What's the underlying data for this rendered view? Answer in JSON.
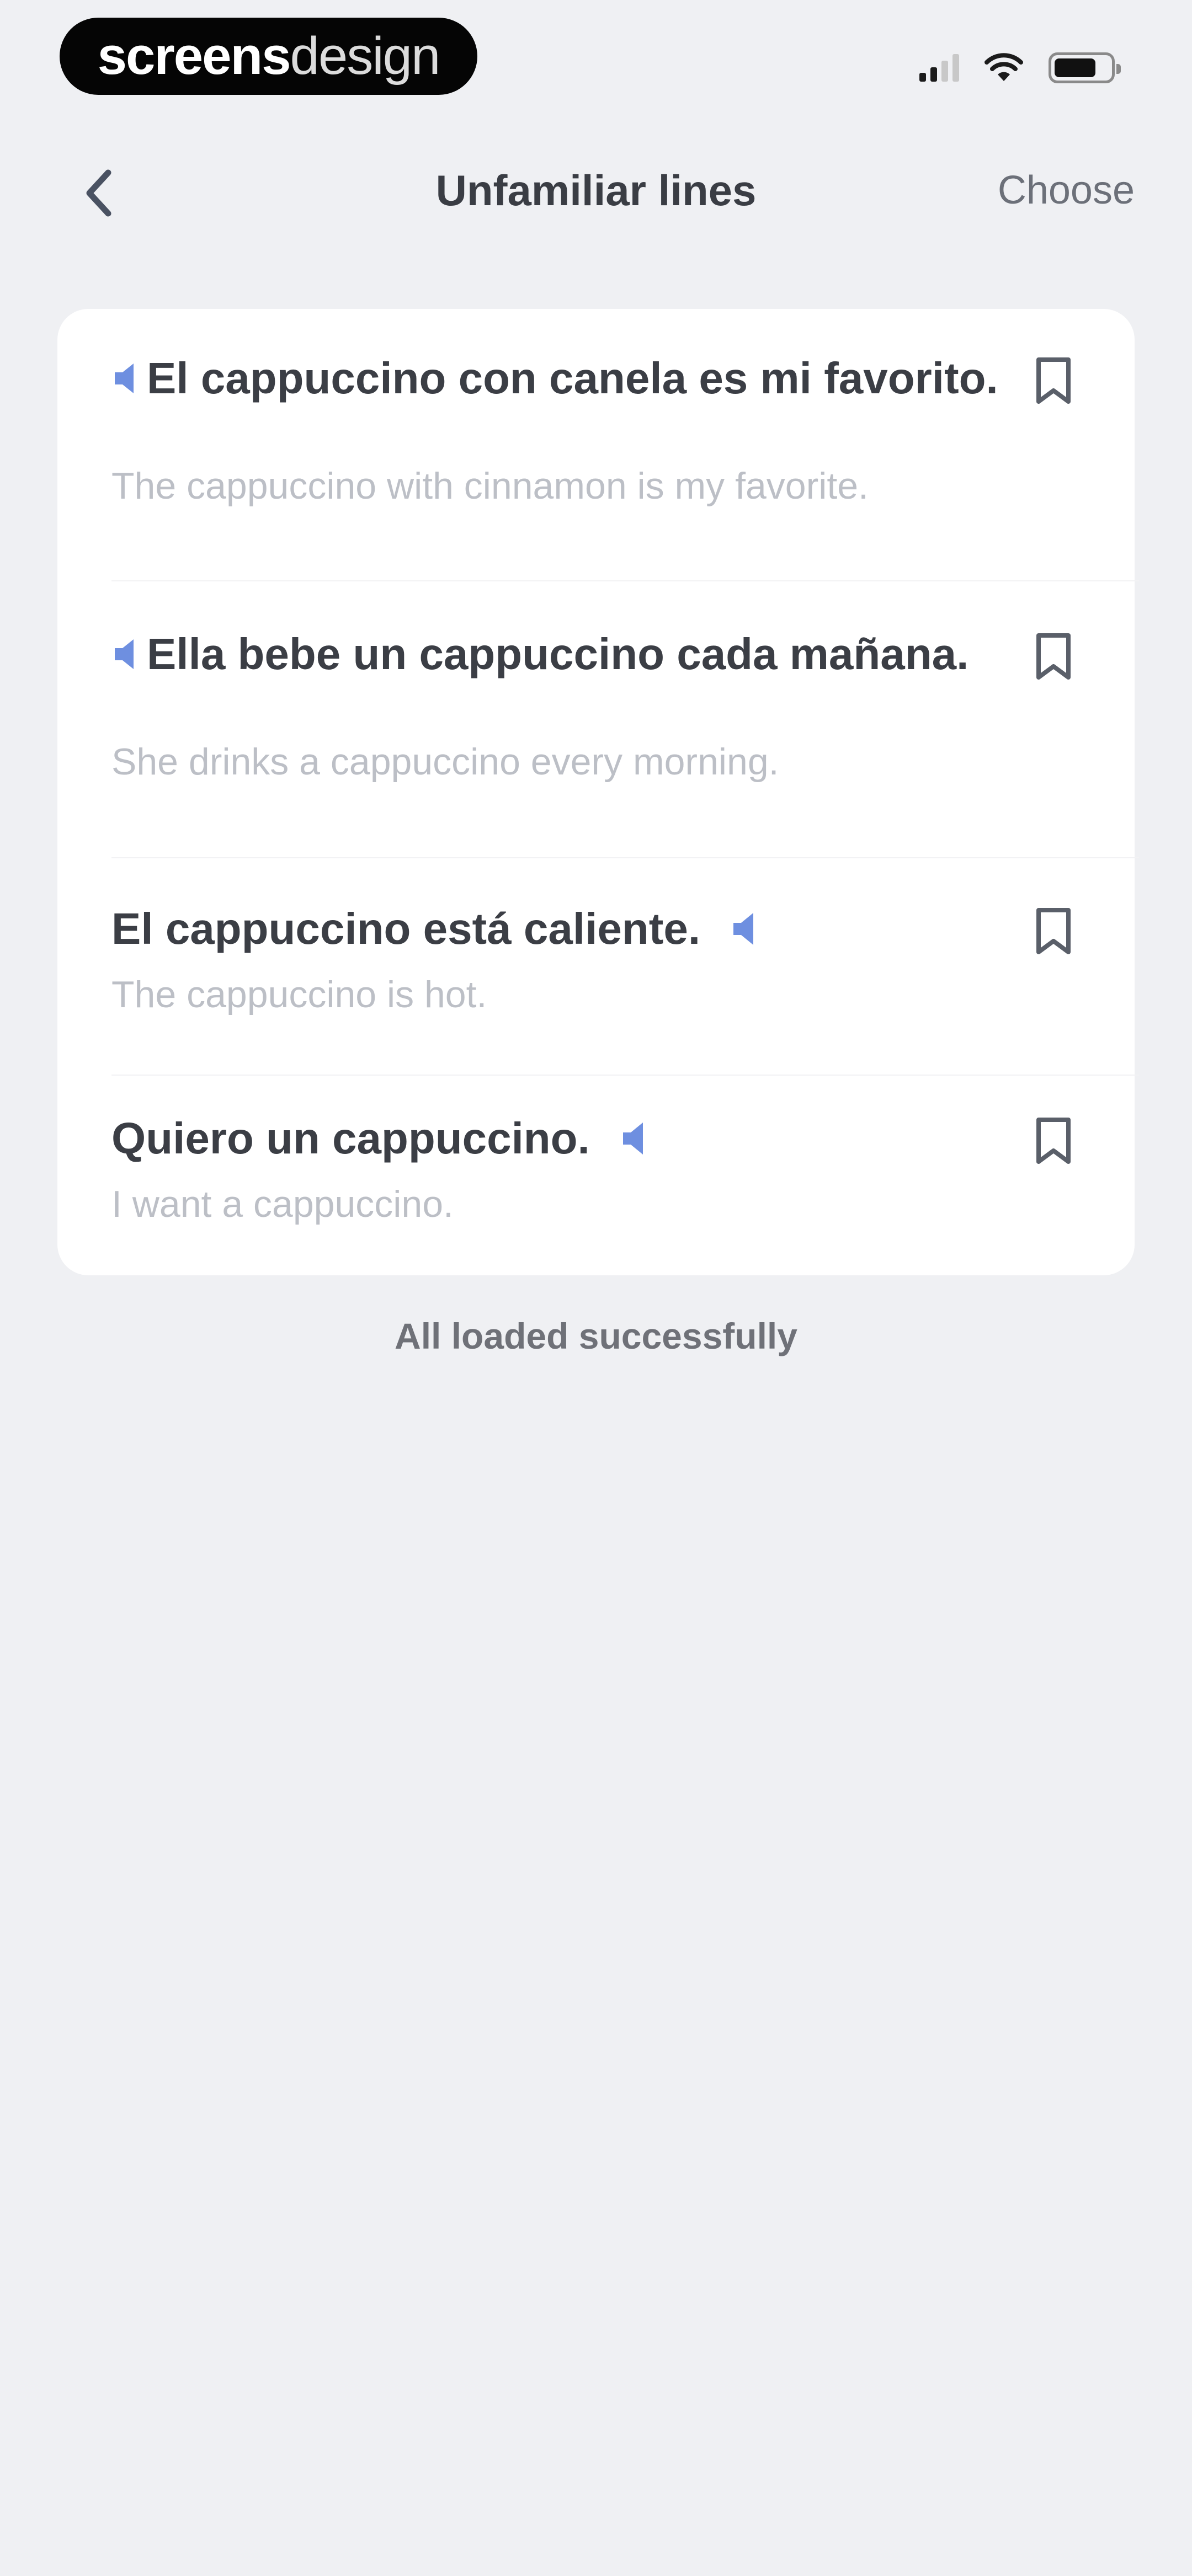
{
  "status_bar": {
    "brand_part1": "screens",
    "brand_part2": "design",
    "battery_level": 0.75
  },
  "nav": {
    "title": "Unfamiliar lines",
    "choose_label": "Choose"
  },
  "lines": [
    {
      "sentence": "El cappuccino con canela es mi favorito.",
      "translation": "The cappuccino with cinnamon is my favorite."
    },
    {
      "sentence": "Ella bebe un cappuccino cada mañana.",
      "translation": "She drinks a cappuccino every morning."
    },
    {
      "sentence": "El cappuccino está caliente.",
      "translation": "The cappuccino is hot."
    },
    {
      "sentence": "Quiero un cappuccino.",
      "translation": "I want a cappuccino."
    }
  ],
  "footer": {
    "status_text": "All loaded successfully"
  },
  "colors": {
    "background": "#eff0f3",
    "card": "#ffffff",
    "accent": "#6e8fe0",
    "sentence_text": "#3b3e45",
    "translation_text": "#bcbfc6"
  },
  "icons": {
    "back": "chevron-left-icon",
    "speaker": "speaker-icon",
    "bookmark": "bookmark-icon"
  }
}
